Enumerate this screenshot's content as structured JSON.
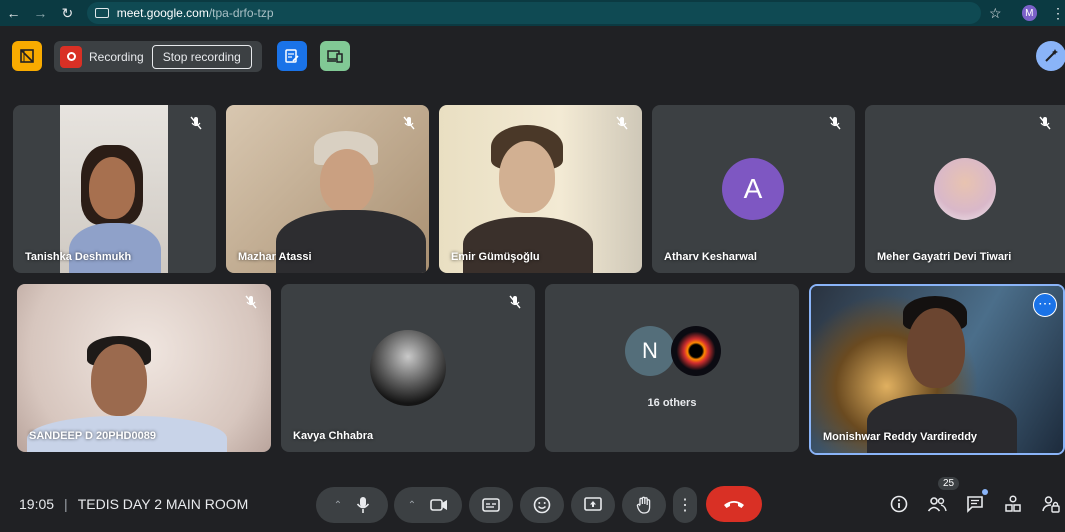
{
  "browser": {
    "url_host": "meet.google.com",
    "url_path": "/tpa-drfo-tzp",
    "profile_initial": "M"
  },
  "topbar": {
    "recording_label": "Recording",
    "stop_recording_label": "Stop recording"
  },
  "tiles": [
    {
      "name": "Tanishka Deshmukh"
    },
    {
      "name": "Mazhar Atassi"
    },
    {
      "name": "Emir Gümüşoğlu"
    },
    {
      "name": "Atharv Kesharwal",
      "initial": "A"
    },
    {
      "name": "Meher Gayatri Devi Tiwari"
    },
    {
      "name": "SANDEEP D 20PHD0089"
    },
    {
      "name": "Kavya Chhabra"
    },
    {
      "name": "16 others",
      "initial": "N"
    },
    {
      "name": "Monishwar Reddy Vardireddy"
    }
  ],
  "bottombar": {
    "time": "19:05",
    "meeting_name": "TEDIS DAY 2 MAIN ROOM",
    "participants_count": "25"
  },
  "colors": {
    "background": "#202124",
    "tile": "#3c4043",
    "leave_red": "#d93025",
    "accent_blue": "#8ab4f8"
  }
}
